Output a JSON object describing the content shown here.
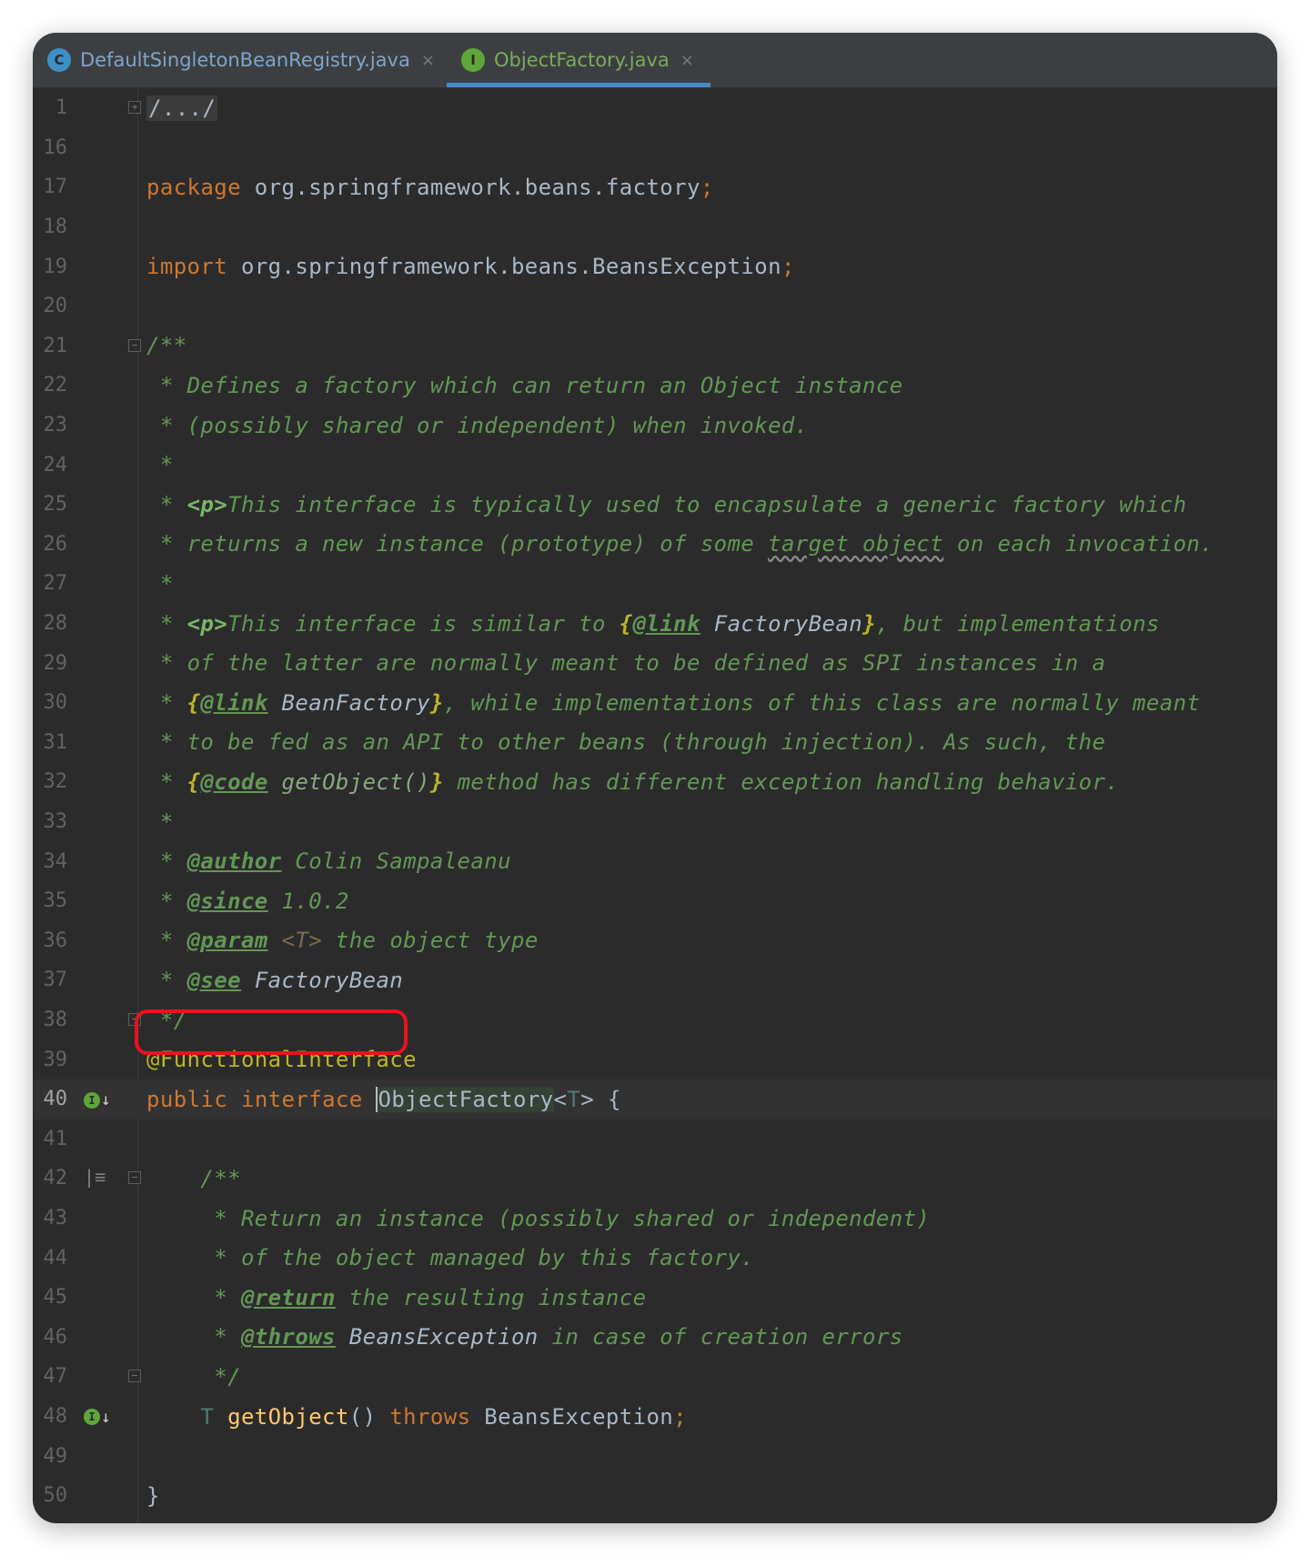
{
  "tabs": [
    {
      "label": "DefaultSingletonBeanRegistry.java",
      "icon_letter": "C",
      "icon": "class-icon",
      "active": false
    },
    {
      "label": "ObjectFactory.java",
      "icon_letter": "I",
      "icon": "interface-icon",
      "active": true
    }
  ],
  "tab_close_glyph": "×",
  "lines": [
    {
      "n": "1"
    },
    {
      "n": "16"
    },
    {
      "n": "17"
    },
    {
      "n": "18"
    },
    {
      "n": "19"
    },
    {
      "n": "20"
    },
    {
      "n": "21"
    },
    {
      "n": "22"
    },
    {
      "n": "23"
    },
    {
      "n": "24"
    },
    {
      "n": "25"
    },
    {
      "n": "26"
    },
    {
      "n": "27"
    },
    {
      "n": "28"
    },
    {
      "n": "29"
    },
    {
      "n": "30"
    },
    {
      "n": "31"
    },
    {
      "n": "32"
    },
    {
      "n": "33"
    },
    {
      "n": "34"
    },
    {
      "n": "35"
    },
    {
      "n": "36"
    },
    {
      "n": "37"
    },
    {
      "n": "38"
    },
    {
      "n": "39"
    },
    {
      "n": "40"
    },
    {
      "n": "41"
    },
    {
      "n": "42"
    },
    {
      "n": "43"
    },
    {
      "n": "44"
    },
    {
      "n": "45"
    },
    {
      "n": "46"
    },
    {
      "n": "47"
    },
    {
      "n": "48"
    },
    {
      "n": "49"
    },
    {
      "n": "50"
    }
  ],
  "code": {
    "folded": "/.../",
    "kw_package": "package",
    "package_name": " org.springframework.beans.factory",
    "kw_import": "import",
    "import_name": " org.springframework.beans.BeansException",
    "semi": ";",
    "doc_open": "/**",
    "doc_star": " * ",
    "doc_star_only": " *",
    "doc_close": " */",
    "l22": "Defines a factory which can return an Object instance",
    "l23": "(possibly shared or independent) when invoked.",
    "p_tag": "<p>",
    "l25": "This interface is typically used to encapsulate a generic factory which",
    "l26a": "returns a new instance (prototype) of some ",
    "l26b": "target object",
    "l26c": " on each invocation.",
    "l28a": "This interface is similar to ",
    "brace_open": "{",
    "brace_close": "}",
    "link": "@link",
    "code_tag": "@code",
    "l28b": " FactoryBean",
    "l28c": ", but implementations",
    "l29": "of the latter are normally meant to be defined as SPI instances in a",
    "l30a": " BeanFactory",
    "l30b": ", while implementations of this class are normally meant",
    "l31": "to be fed as an API to other beans (through injection). As such, the",
    "l32a": " getObject()",
    "l32b": " method has different exception handling behavior.",
    "author": "@author",
    "author_val": " Colin Sampaleanu",
    "since": "@since",
    "since_val": " 1.0.2",
    "param": "@param",
    "param_t": " <T>",
    "param_val": " the object type",
    "see": "@see",
    "see_val": " FactoryBean",
    "annotation": "@FunctionalInterface",
    "kw_public": "public",
    "kw_interface": "interface",
    "type_name": "ObjectFactory",
    "generic_open": "<",
    "generic_t": "T",
    "generic_close": ">",
    "open_brace": " {",
    "inner_doc_open": "    /**",
    "inner_star": "     * ",
    "inner_close": "     */",
    "l43": "Return an instance (possibly shared or independent)",
    "l44": "of the object managed by this factory.",
    "return_tag": "@return",
    "return_val": " the resulting instance",
    "throws_tag": "@throws",
    "throws_ref": " BeansException",
    "throws_val": " in case of creation errors",
    "ret_type": "    T ",
    "method_name": "getObject",
    "parens": "()",
    "kw_throws": " throws",
    "exception": " BeansException",
    "close_brace": "}"
  },
  "gutter_icons": {
    "implemented_letter": "I",
    "arrow": "↓",
    "doc_glyph": "|≡"
  },
  "colors": {
    "editor_bg": "#2b2b2b",
    "keyword": "#cc7832",
    "javadoc": "#629755",
    "annotation": "#bbb529",
    "method": "#ffc66d",
    "highlight_circle": "#e8131c",
    "active_tab_underline": "#4a88c7"
  }
}
